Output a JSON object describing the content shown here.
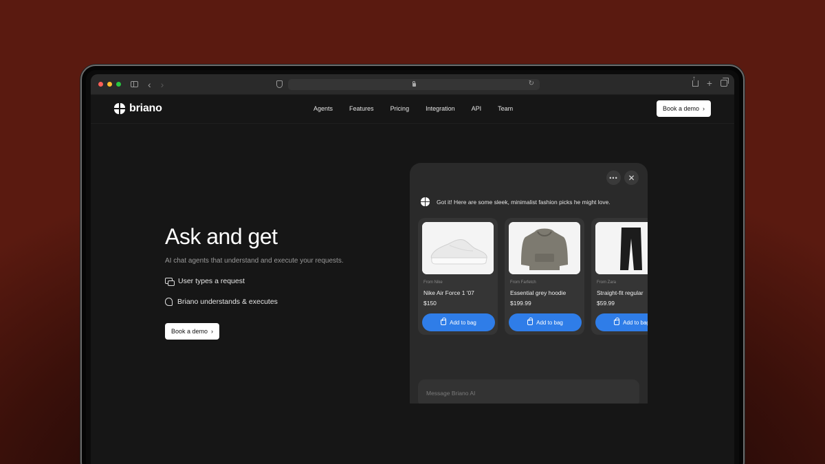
{
  "brand": {
    "name": "briano"
  },
  "nav": {
    "links": [
      "Agents",
      "Features",
      "Pricing",
      "Integration",
      "API",
      "Team"
    ],
    "cta": "Book a demo"
  },
  "hero": {
    "title": "Ask and get",
    "subtitle": "AI chat agents that understand and execute your requests.",
    "features": [
      "User types a request",
      "Briano understands & executes"
    ],
    "cta": "Book a demo"
  },
  "chat": {
    "bot_message": "Got it! Here are some sleek, minimalist fashion picks he might love.",
    "products": [
      {
        "source": "From Nike",
        "name": "Nike Air Force 1 '07",
        "price": "$150",
        "button": "Add to bag"
      },
      {
        "source": "From Farfetch",
        "name": "Essential grey hoodie",
        "price": "$199.99",
        "button": "Add to bag"
      },
      {
        "source": "From Zara",
        "name": "Straight-fit regular",
        "price": "$59.99",
        "button": "Add to bag"
      }
    ],
    "input_placeholder": "Message Briano AI"
  },
  "colors": {
    "accent": "#2f7de8",
    "background": "#161616",
    "panel": "#2a2a2a"
  },
  "icons": [
    "sidebar-icon",
    "back-icon",
    "forward-icon",
    "shield-icon",
    "lock-icon",
    "reload-icon",
    "share-icon",
    "plus-icon",
    "tabs-icon",
    "chat-bubbles-icon",
    "head-icon",
    "more-icon",
    "close-icon",
    "bag-icon"
  ]
}
